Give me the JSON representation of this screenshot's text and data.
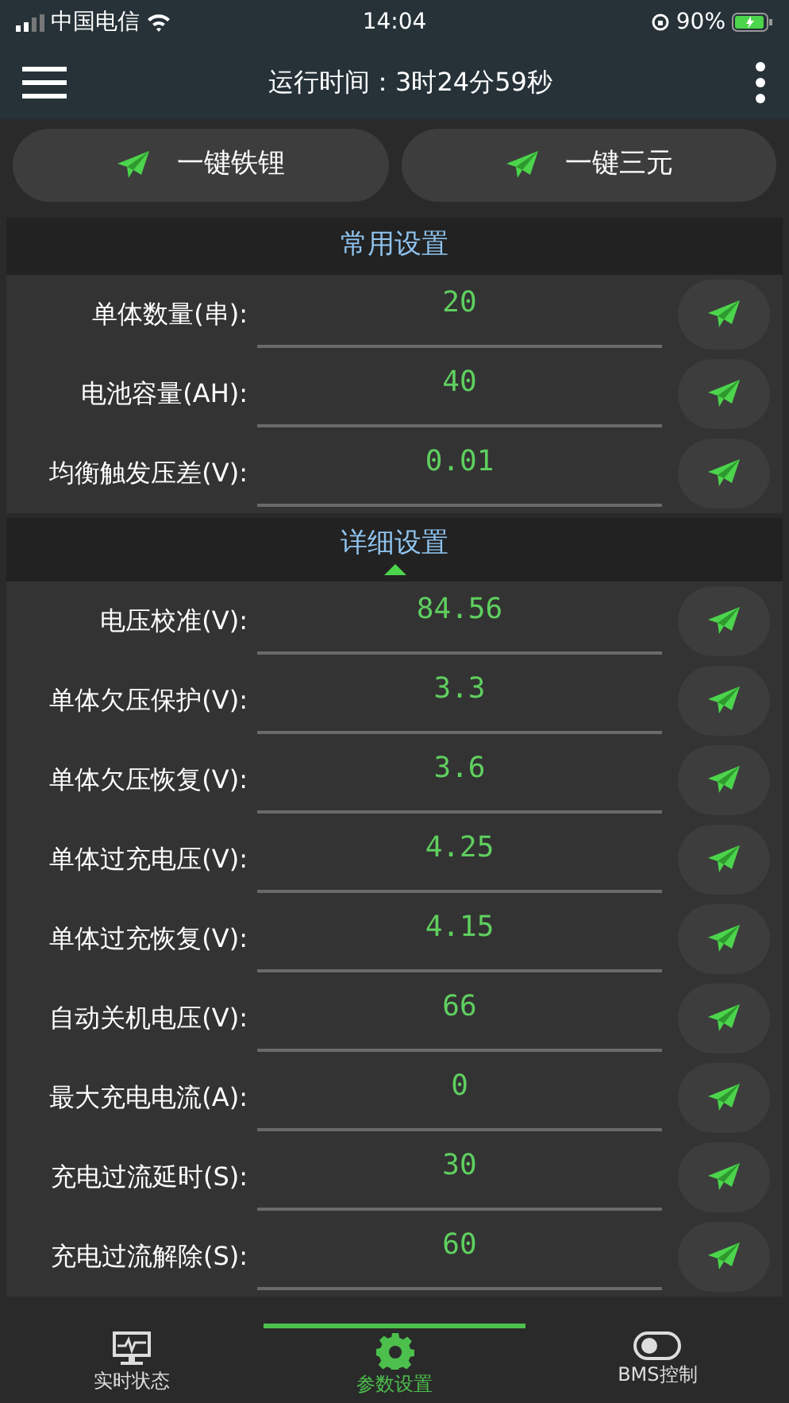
{
  "status_bar": {
    "carrier": "中国电信",
    "time": "14:04",
    "battery": "90%"
  },
  "app_bar": {
    "title": "运行时间：3时24分59秒"
  },
  "quick_buttons": [
    "一键铁锂",
    "一键三元"
  ],
  "sections": [
    {
      "title": "常用设置",
      "rows": [
        {
          "label": "单体数量(串):",
          "value": "20"
        },
        {
          "label": "电池容量(AH):",
          "value": "40"
        },
        {
          "label": "均衡触发压差(V):",
          "value": "0.01"
        }
      ]
    },
    {
      "title": "详细设置",
      "expanded": true,
      "rows": [
        {
          "label": "电压校准(V):",
          "value": "84.56"
        },
        {
          "label": "单体欠压保护(V):",
          "value": "3.3"
        },
        {
          "label": "单体欠压恢复(V):",
          "value": "3.6"
        },
        {
          "label": "单体过充电压(V):",
          "value": "4.25"
        },
        {
          "label": "单体过充恢复(V):",
          "value": "4.15"
        },
        {
          "label": "自动关机电压(V):",
          "value": "66"
        },
        {
          "label": "最大充电电流(A):",
          "value": "0"
        },
        {
          "label": "充电过流延时(S):",
          "value": "30"
        },
        {
          "label": "充电过流解除(S):",
          "value": "60"
        }
      ]
    }
  ],
  "bottom_nav": [
    {
      "label": "实时状态",
      "selected": false
    },
    {
      "label": "参数设置",
      "selected": true
    },
    {
      "label": "BMS控制",
      "selected": false
    }
  ]
}
